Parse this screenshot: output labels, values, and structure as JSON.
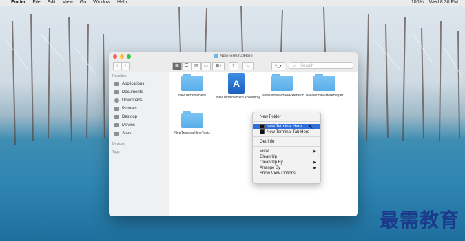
{
  "menubar": {
    "app": "Finder",
    "items": [
      "File",
      "Edit",
      "View",
      "Go",
      "Window",
      "Help"
    ],
    "status": [
      "100%",
      "Wed 8:30 PM"
    ]
  },
  "window": {
    "title": "NewTerminalHere",
    "search_placeholder": "Search"
  },
  "sidebar": {
    "favorites_header": "Favorites",
    "items": [
      {
        "label": "Applications",
        "icon": "applications-icon"
      },
      {
        "label": "Documents",
        "icon": "documents-icon"
      },
      {
        "label": "Downloads",
        "icon": "downloads-icon"
      },
      {
        "label": "Pictures",
        "icon": "pictures-icon"
      },
      {
        "label": "Desktop",
        "icon": "desktop-icon"
      },
      {
        "label": "Movies",
        "icon": "movies-icon"
      },
      {
        "label": "Sites",
        "icon": "sites-icon"
      }
    ],
    "devices_header": "Devices",
    "tags_header": "Tags"
  },
  "files": [
    {
      "name": "NewTerminalHere",
      "type": "folder"
    },
    {
      "name": "NewTerminalHere.xcodeproj",
      "type": "xcodeproj"
    },
    {
      "name": "NewTerminalHereExtension",
      "type": "folder"
    },
    {
      "name": "NewTerminalHereHelper",
      "type": "folder"
    },
    {
      "name": "NewTerminalHereTests",
      "type": "folder"
    }
  ],
  "context_menu": {
    "items": [
      {
        "label": "New Folder"
      },
      {
        "label": "New Terminal Here",
        "selected": true
      },
      {
        "label": "New Terminal Tab Here"
      },
      {
        "label": "Get Info"
      },
      {
        "label": "View",
        "submenu": true
      },
      {
        "label": "Clean Up"
      },
      {
        "label": "Clean Up By",
        "submenu": true
      },
      {
        "label": "Arrange By",
        "submenu": true
      },
      {
        "label": "Show View Options"
      }
    ]
  },
  "watermark": "最需教育",
  "colors": {
    "selection": "#2f6fdb",
    "folder": "#58adea"
  }
}
